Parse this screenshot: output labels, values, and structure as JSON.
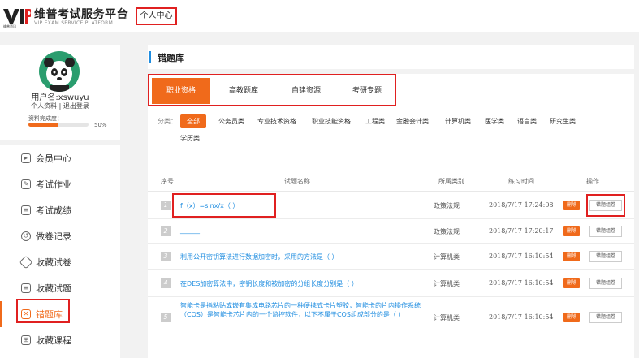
{
  "header": {
    "logo_mark": "VIP",
    "logo_small": "维普资讯",
    "site_title": "维普考试服务平台",
    "site_subtitle": "VIP EXAM SERVICE PLATFORM",
    "crumb_sep": "/",
    "crumb_current": "个人中心"
  },
  "profile": {
    "username": "用户名:xswuyu",
    "links": "个人资料 | 退出登录",
    "complete_label": "资料完成度：",
    "complete_pct": "50%",
    "complete_value": 0.5
  },
  "menu": [
    {
      "label": "会员中心",
      "icon": "play-icon"
    },
    {
      "label": "考试作业",
      "icon": "edit-icon"
    },
    {
      "label": "考试成绩",
      "icon": "grade-icon"
    },
    {
      "label": "做卷记录",
      "icon": "history-icon"
    },
    {
      "label": "收藏试卷",
      "icon": "layers-icon"
    },
    {
      "label": "收藏试题",
      "icon": "list-icon"
    },
    {
      "label": "错题库",
      "icon": "wrong-book-icon",
      "active": true
    },
    {
      "label": "收藏课程",
      "icon": "grid-icon"
    }
  ],
  "panel_title": "错题库",
  "tabs": [
    {
      "label": "职业资格",
      "active": true
    },
    {
      "label": "高教题库"
    },
    {
      "label": "自建资源"
    },
    {
      "label": "考研专题"
    }
  ],
  "categories": {
    "label": "分类：",
    "items": [
      "全部",
      "公务员类",
      "专业技术资格",
      "职业技能资格",
      "工程类",
      "金融会计类",
      "计算机类",
      "医学类",
      "语言类",
      "研究生类",
      "学历类"
    ]
  },
  "table": {
    "headers": [
      "序号",
      "试题名称",
      "所属类别",
      "练习时间",
      "操作"
    ],
    "delete_label": "删除",
    "group_label": "错题组卷",
    "rows": [
      {
        "num": "1",
        "title": "f（x）=sinx/x（ ）",
        "category": "政策法规",
        "time": "2018/7/17 17:24:08"
      },
      {
        "num": "2",
        "title": "______",
        "category": "政策法规",
        "time": "2018/7/17 17:20:17"
      },
      {
        "num": "3",
        "title": "利用公开密钥算法进行数据加密时，采用的方法是（ ）",
        "category": "计算机类",
        "time": "2018/7/17 16:10:54"
      },
      {
        "num": "4",
        "title": "在DES加密算法中，密钥长度和被加密的分组长度分别是（ ）",
        "category": "计算机类",
        "time": "2018/7/17 16:10:54"
      },
      {
        "num": "5",
        "title": "智能卡是指粘贴或嵌有集成电路芯片的一种便携式卡片塑胶，智能卡的片内操作系统（COS）是智能卡芯片内的一个监控软件，以下不属于COS组成部分的是（ ）",
        "category": "计算机类",
        "time": "2018/7/17 16:10:54"
      }
    ]
  }
}
